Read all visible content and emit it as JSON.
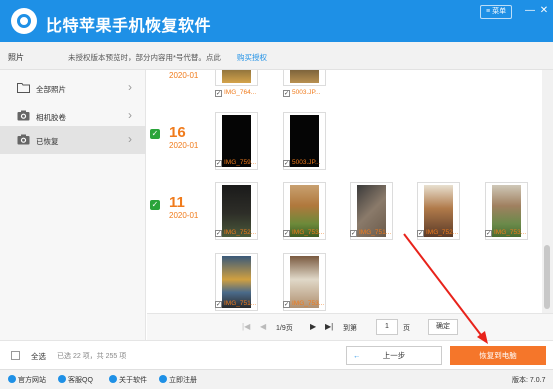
{
  "app": {
    "title": "比特苹果手机恢复软件",
    "menu_label": "菜单",
    "menu_icon": "list-icon",
    "minimize_glyph": "—",
    "close_glyph": "✕",
    "brand_color": "#1e90e6"
  },
  "notice": {
    "section": "照片",
    "text": "未授权版本预览时，部分内容用*号代替。点此",
    "link": "购买授权"
  },
  "sidebar": {
    "items": [
      {
        "label": "全部照片",
        "icon": "folder-icon"
      },
      {
        "label": "相机胶卷",
        "icon": "camera-icon"
      },
      {
        "label": "已恢复",
        "icon": "camera-icon"
      }
    ]
  },
  "content": {
    "groups": [
      {
        "day": "",
        "year": "2020-01",
        "checked": false,
        "items": [
          "IMG_764...",
          "5003.JP..."
        ]
      },
      {
        "day": "16",
        "year": "2020-01",
        "checked": true,
        "items": [
          "IMG_759...",
          "5003.JP..."
        ]
      },
      {
        "day": "11",
        "year": "2020-01",
        "checked": true,
        "items": [
          "IMG_752...",
          "IMG_753...",
          "IMG_751...",
          "IMG_752...",
          "IMG_753...",
          "IMG_751...",
          "IMG_753..."
        ]
      }
    ],
    "check_mark": "✓",
    "accent_color": "#f07b1c"
  },
  "pager": {
    "first": "|◀",
    "prev": "◀",
    "page_info": "1/9页",
    "next": "▶",
    "last": "▶|",
    "goto_label": "到第",
    "goto_value": "1",
    "page_unit": "页",
    "confirm": "确定"
  },
  "actions": {
    "select_all": "全选",
    "selection_count": "已选 22 项，共 255 项",
    "prev_step": "上一步",
    "prev_arrow": "←",
    "recover": "恢复到电脑",
    "recover_color": "#f5762a"
  },
  "footer": {
    "links": [
      "官方网站",
      "客服QQ",
      "关于软件",
      "立即注册"
    ],
    "version": "版本: 7.0.7"
  }
}
